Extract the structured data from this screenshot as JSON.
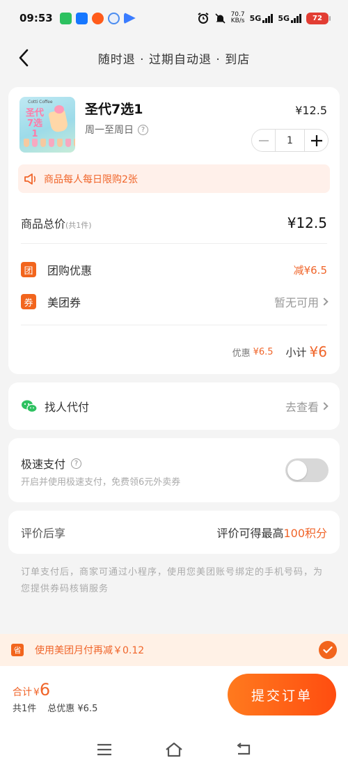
{
  "status_bar": {
    "time": "09:53",
    "net_speed_top": "70.7",
    "net_speed_bottom": "KB/s",
    "signal1": "5G",
    "signal2": "5G",
    "battery": "72"
  },
  "header": {
    "title": "随时退 · 过期自动退 · 到店"
  },
  "product": {
    "thumb_brand": "Cotti Coffee",
    "thumb_title": "圣代7选1",
    "name": "圣代7选1",
    "schedule": "周一至周日",
    "price": "¥12.5",
    "quantity": "1"
  },
  "limit_notice": "商品每人每日限购2张",
  "summary": {
    "total_label": "商品总价",
    "total_count": "(共1件)",
    "total_value": "¥12.5",
    "group_tag": "团",
    "group_label": "团购优惠",
    "group_value": "减¥6.5",
    "coupon_tag": "券",
    "coupon_label": "美团券",
    "coupon_value": "暂无可用",
    "discount_label": "优惠",
    "discount_value": "¥6.5",
    "subtotal_label": "小计",
    "subtotal_value": "¥6"
  },
  "proxy_pay": {
    "label": "找人代付",
    "action": "去查看"
  },
  "fast_pay": {
    "title": "极速支付",
    "desc": "开启并使用极速支付，免费领6元外卖券",
    "enabled": false
  },
  "review": {
    "label": "评价后享",
    "text": "评价可得最高",
    "points": "100积分"
  },
  "footnote": "订单支付后，商家可通过小程序，使用您美团账号绑定的手机号码，为您提供券码核销服务",
  "monthly_pay": {
    "icon": "省",
    "text": "使用美团月付再减￥0.12",
    "checked": true
  },
  "bottom": {
    "total_label": "合计",
    "total_currency": "¥",
    "total_value": "6",
    "count": "共1件",
    "discount": "总优惠 ¥6.5",
    "submit_label": "提交订单"
  },
  "colors": {
    "accent": "#f2651d",
    "accent_text": "#f0652a",
    "notice_bg": "#fff0ea",
    "page_bg": "#f4f4f4"
  }
}
